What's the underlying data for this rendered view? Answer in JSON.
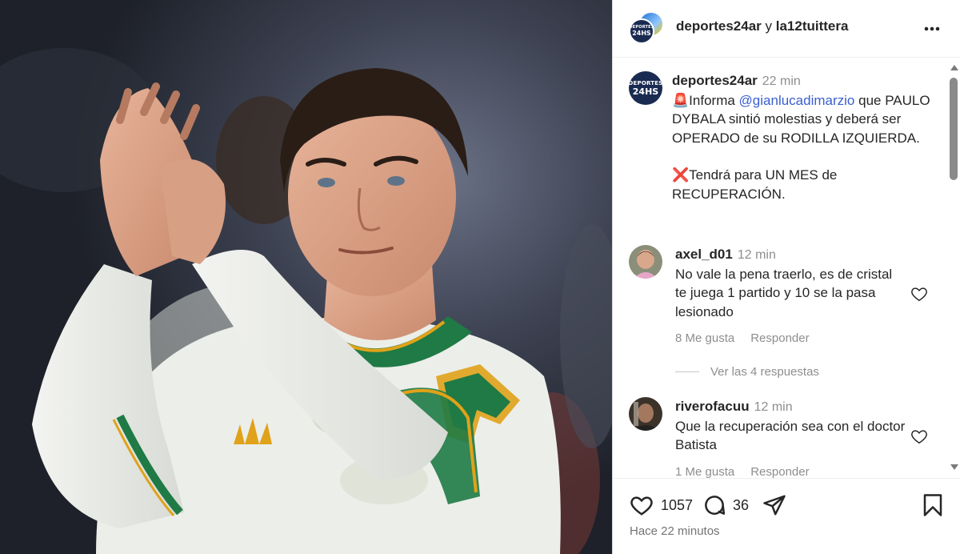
{
  "header": {
    "author": "deportes24ar",
    "conjunction": "y",
    "collaborator": "la12tuittera",
    "avatar_logo_top": "DEPORTES",
    "avatar_logo_bottom": "24HS"
  },
  "caption": {
    "username": "deportes24ar",
    "time": "22 min",
    "siren_emoji": "🚨",
    "intro": "Informa",
    "mention": "@gianlucadimarzio",
    "body_1": "que PAULO DYBALA sintió molestias y deberá ser OPERADO de su RODILLA IZQUIERDA.",
    "cross_emoji": "❌",
    "body_2": "Tendrá para UN MES de RECUPERACIÓN."
  },
  "comments": [
    {
      "username": "axel_d01",
      "time": "12 min",
      "text": "No vale la pena traerlo, es de cristal te juega 1 partido y 10 se la pasa lesionado",
      "likes": "8 Me gusta",
      "reply_label": "Responder",
      "view_replies": "Ver las 4 respuestas"
    },
    {
      "username": "riverofacuu",
      "time": "12 min",
      "text": "Que la recuperación sea con el doctor Batista",
      "likes": "1 Me gusta",
      "reply_label": "Responder"
    }
  ],
  "actions": {
    "likes_count": "1057",
    "comments_count": "36",
    "posted_time": "Hace 22 minutos"
  },
  "colors": {
    "mention": "#3a5fcf",
    "muted": "#8e8e8e",
    "jersey": "#eef0ec",
    "jersey_green": "#1f7a45",
    "jersey_gold": "#e0a21a"
  }
}
